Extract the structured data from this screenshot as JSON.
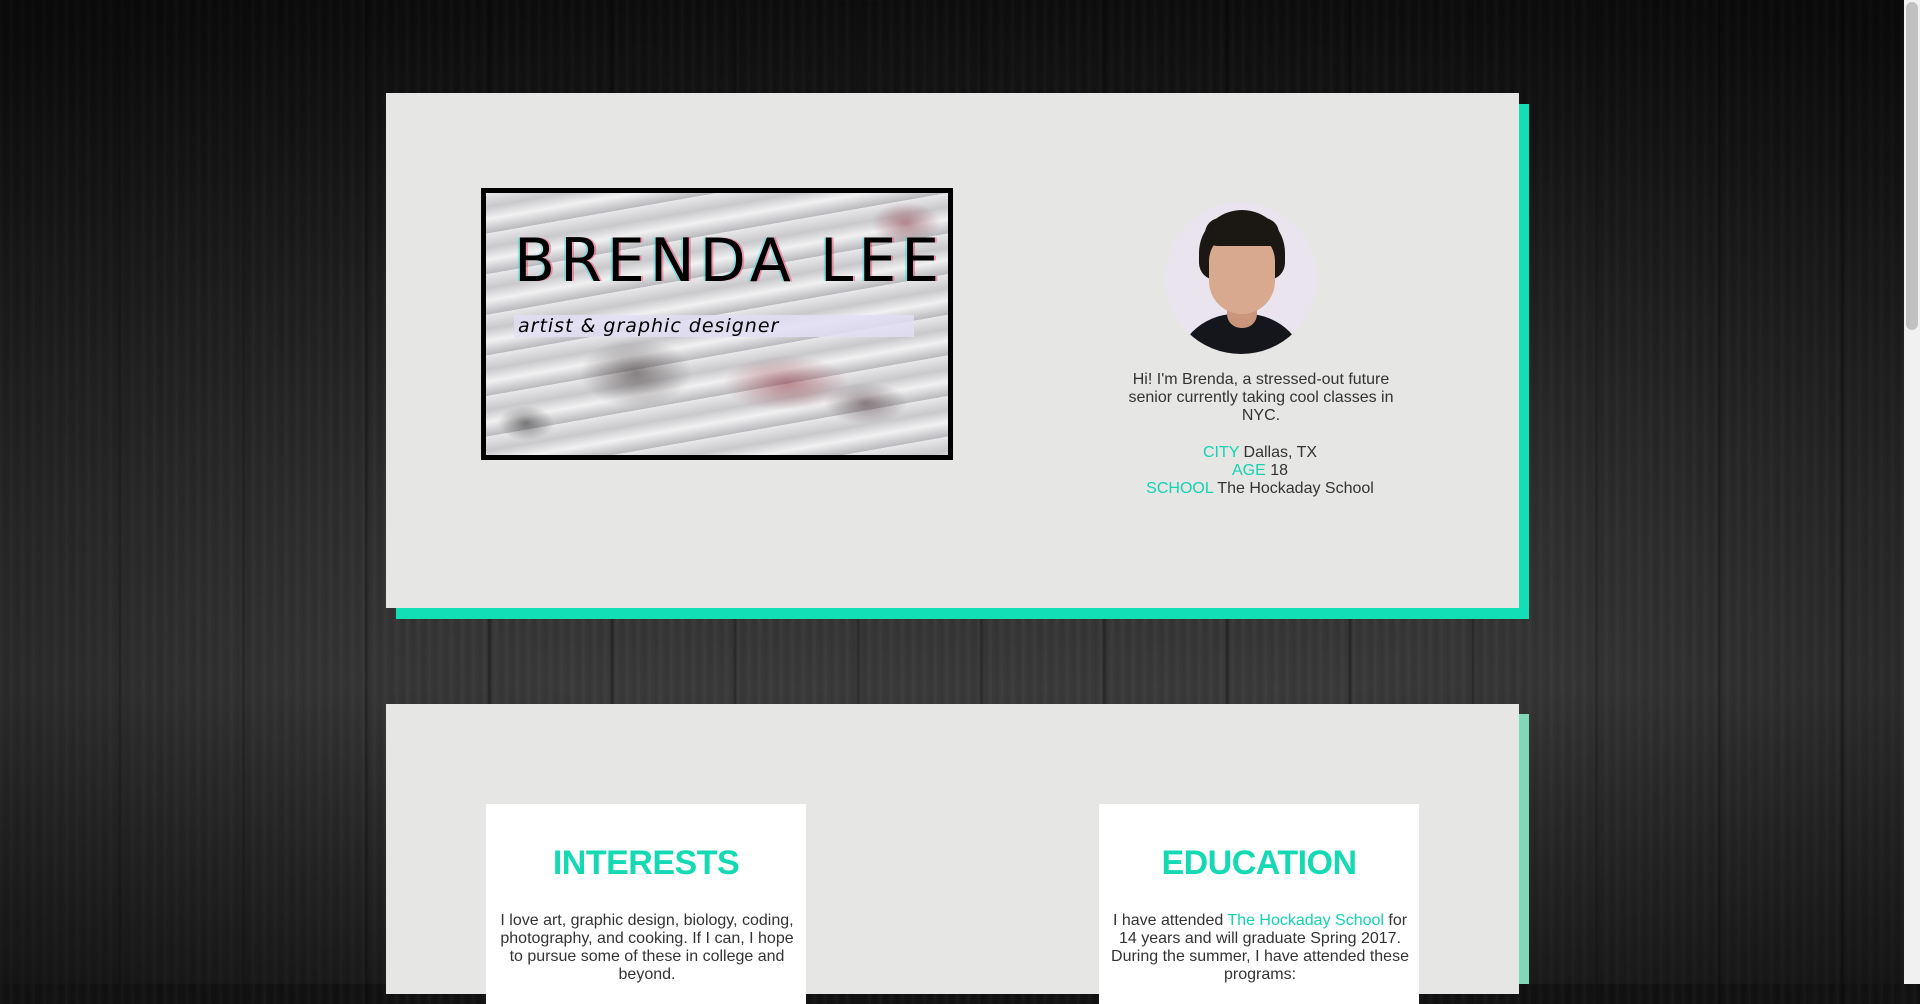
{
  "header": {
    "name": "BRENDA LEE",
    "subtitle": "artist & graphic designer"
  },
  "profile": {
    "bio": "Hi! I'm Brenda, a stressed-out future senior currently taking cool classes in NYC.",
    "facts": [
      {
        "key": "CITY",
        "value": "Dallas, TX"
      },
      {
        "key": "AGE",
        "value": "18"
      },
      {
        "key": "SCHOOL",
        "value": "The Hockaday School"
      }
    ]
  },
  "interests": {
    "title": "INTERESTS",
    "text": "I love art, graphic design, biology, coding, photography, and cooking. If I can, I hope to pursue some of these in college and beyond."
  },
  "education": {
    "title": "EDUCATION",
    "text_before": "I have attended ",
    "link": "The Hockaday School",
    "text_after": " for 14 years and will graduate Spring 2017. During the summer, I have attended these programs:"
  },
  "colors": {
    "accent": "#13dfb7",
    "card": "#e6e6e4"
  },
  "icons": {
    "profile_photo": "portrait-photo"
  }
}
